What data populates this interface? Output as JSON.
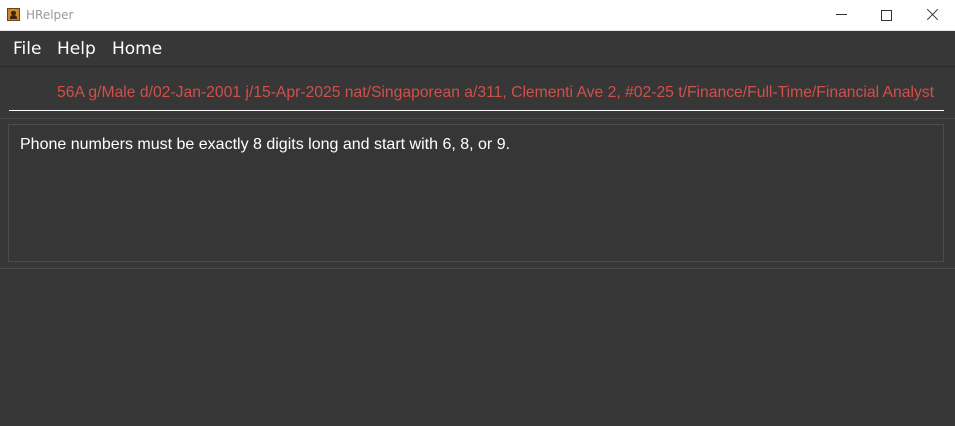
{
  "window": {
    "title": "HRelper"
  },
  "menu": {
    "items": [
      "File",
      "Help",
      "Home"
    ]
  },
  "command_box": {
    "value": "56A g/Male d/02-Jan-2001 j/15-Apr-2025 nat/Singaporean a/311, Clementi Ave 2, #02-25 t/Finance/Full-Time/Financial Analyst",
    "text_color": "#d0504a"
  },
  "result_display": {
    "message": "Phone numbers must be exactly 8 digits long and start with 6, 8, or 9."
  },
  "icons": {
    "app": "app-icon",
    "minimize": "minimize-icon",
    "maximize": "maximize-icon",
    "close": "close-icon"
  },
  "colors": {
    "background": "#373737",
    "error_text": "#d0504a"
  }
}
